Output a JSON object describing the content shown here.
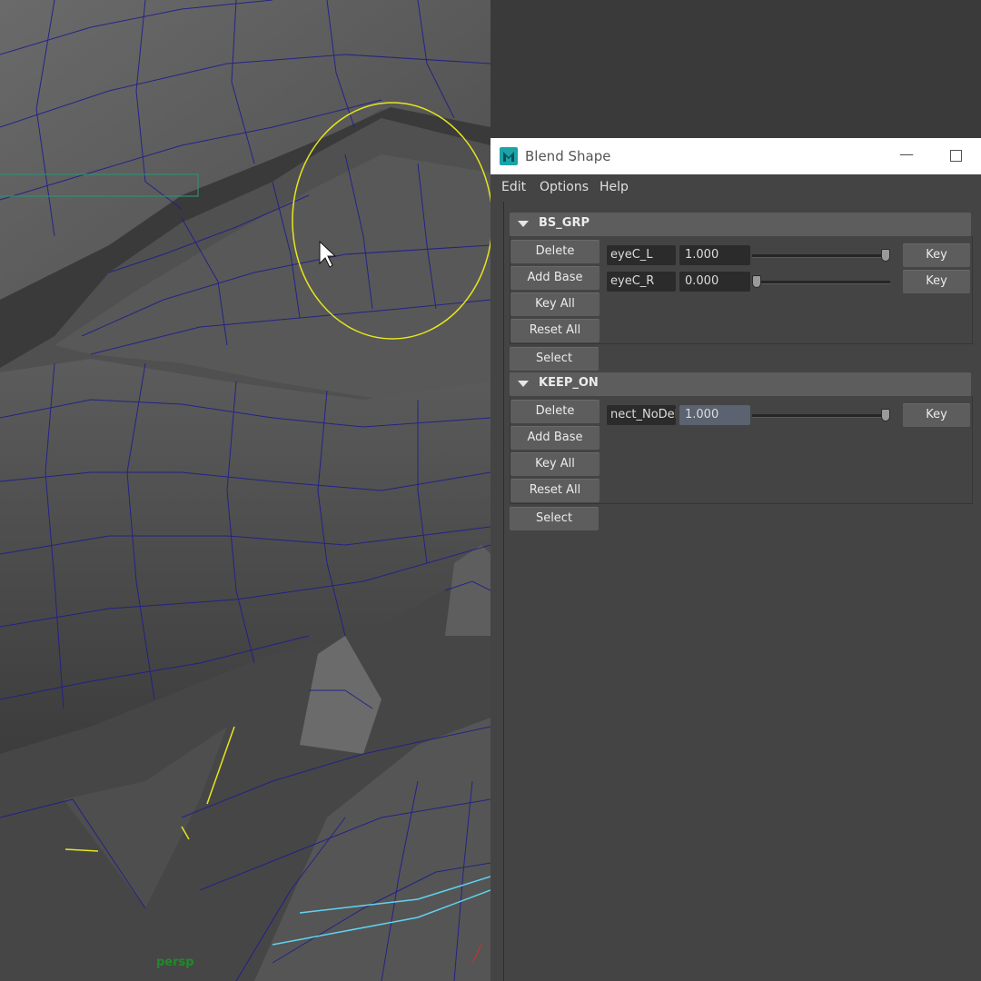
{
  "viewport": {
    "camera_label": "persp"
  },
  "window": {
    "title": "Blend Shape",
    "minimize_glyph": "—",
    "icon": "maya-app-icon"
  },
  "menu": [
    "Edit",
    "Options",
    "Help"
  ],
  "groups": [
    {
      "name": "BS_GRP",
      "buttons": [
        "Delete",
        "Add Base",
        "Key All",
        "Reset All"
      ],
      "select_label": "Select",
      "targets": [
        {
          "name": "eyeC_L",
          "weight": "1.000",
          "level": 1.0,
          "key_label": "Key"
        },
        {
          "name": "eyeC_R",
          "weight": "0.000",
          "level": 0.0,
          "key_label": "Key"
        }
      ]
    },
    {
      "name": "KEEP_ON",
      "buttons": [
        "Delete",
        "Add Base",
        "Key All",
        "Reset All"
      ],
      "select_label": "Select",
      "targets": [
        {
          "name": "nect_NoDel",
          "weight": "1.000",
          "level": 1.0,
          "key_label": "Key"
        }
      ]
    }
  ]
}
